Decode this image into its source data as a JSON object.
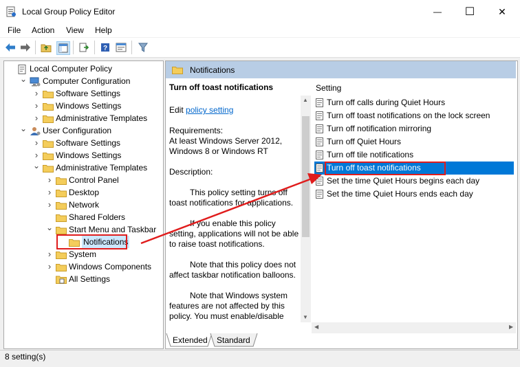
{
  "window": {
    "title": "Local Group Policy Editor",
    "controls": {
      "minimize": "—",
      "maximize": "☐",
      "close": "✕"
    }
  },
  "menu": [
    "File",
    "Action",
    "View",
    "Help"
  ],
  "toolbar": {
    "icons": [
      "back-arrow-icon",
      "forward-arrow-icon",
      "folder-up-icon",
      "console-tree-icon",
      "export-list-icon",
      "help-icon",
      "properties-icon",
      "filter-icon"
    ]
  },
  "tree": [
    {
      "label": "Local Computer Policy",
      "icon": "policy-doc-icon",
      "chevron": ""
    },
    {
      "label": "Computer Configuration",
      "icon": "computer-icon",
      "chevron": "expanded"
    },
    {
      "label": "Software Settings",
      "icon": "folder-icon",
      "chevron": "collapsed"
    },
    {
      "label": "Windows Settings",
      "icon": "folder-icon",
      "chevron": "collapsed"
    },
    {
      "label": "Administrative Templates",
      "icon": "folder-icon",
      "chevron": "collapsed"
    },
    {
      "label": "User Configuration",
      "icon": "user-icon",
      "chevron": "expanded"
    },
    {
      "label": "Software Settings",
      "icon": "folder-icon",
      "chevron": "collapsed"
    },
    {
      "label": "Windows Settings",
      "icon": "folder-icon",
      "chevron": "collapsed"
    },
    {
      "label": "Administrative Templates",
      "icon": "folder-icon",
      "chevron": "expanded"
    },
    {
      "label": "Control Panel",
      "icon": "folder-icon",
      "chevron": "collapsed"
    },
    {
      "label": "Desktop",
      "icon": "folder-icon",
      "chevron": "collapsed"
    },
    {
      "label": "Network",
      "icon": "folder-icon",
      "chevron": "collapsed"
    },
    {
      "label": "Shared Folders",
      "icon": "folder-icon",
      "chevron": ""
    },
    {
      "label": "Start Menu and Taskbar",
      "icon": "folder-icon",
      "chevron": "expanded"
    },
    {
      "label": "Notifications",
      "icon": "folder-icon",
      "chevron": "",
      "selected": true
    },
    {
      "label": "System",
      "icon": "folder-icon",
      "chevron": "collapsed"
    },
    {
      "label": "Windows Components",
      "icon": "folder-icon",
      "chevron": "collapsed"
    },
    {
      "label": "All Settings",
      "icon": "all-settings-icon",
      "chevron": ""
    }
  ],
  "right_header": "Notifications",
  "description": {
    "title": "Turn off toast notifications",
    "edit_prefix": "Edit ",
    "edit_link": "policy setting",
    "requirements_label": "Requirements:",
    "requirements_text": "At least Windows Server 2012, Windows 8 or Windows RT",
    "description_label": "Description:",
    "paragraphs": [
      "This policy setting turns off toast notifications for applications.",
      "If you enable this policy setting, applications will not be able to raise toast notifications.",
      "Note that this policy does not affect taskbar notification balloons.",
      "Note that Windows system features are not affected by this policy.  You must enable/disable"
    ]
  },
  "settings_header": "Setting",
  "settings": [
    "Turn off calls during Quiet Hours",
    "Turn off toast notifications on the lock screen",
    "Turn off notification mirroring",
    "Turn off Quiet Hours",
    "Turn off tile notifications",
    "Turn off toast notifications",
    "Set the time Quiet Hours begins each day",
    "Set the time Quiet Hours ends each day"
  ],
  "selected_setting_index": 5,
  "tabs": [
    "Extended",
    "Standard"
  ],
  "status": "8 setting(s)",
  "colors": {
    "selection": "#0078d7",
    "highlight_box": "#e01c1c",
    "header": "#b8cde5",
    "link": "#0066cc"
  }
}
